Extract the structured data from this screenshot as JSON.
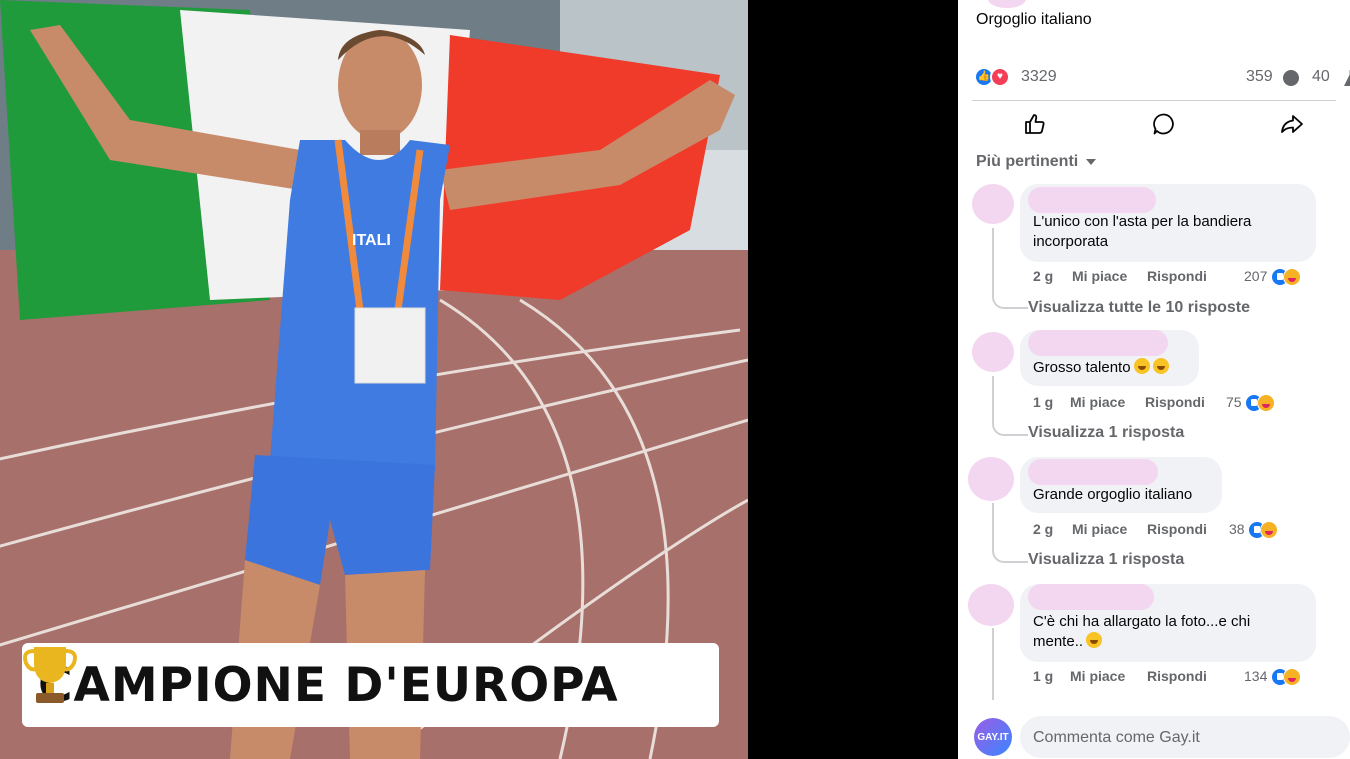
{
  "photo": {
    "caption": "CAMPIONE D'EUROPA",
    "trophy_icon": "trophy-icon",
    "jersey_text": "ITALI",
    "flag_colors": [
      "#1f9b3b",
      "#f2f2f2",
      "#f03a2a"
    ]
  },
  "post": {
    "text": "Orgoglio italiano",
    "reaction_count": "3329",
    "comment_count": "359",
    "share_count": "40"
  },
  "actions": {
    "like_icon": "like-icon",
    "comment_icon": "comment-icon",
    "share_icon": "share-icon"
  },
  "sort_label": "Più pertinenti",
  "comments": [
    {
      "text": "L'unico con l'asta per la bandiera incorporata",
      "time": "2 g",
      "like": "Mi piace",
      "reply": "Rispondi",
      "reactions": "207",
      "replies_link": "Visualizza tutte le 10 risposte"
    },
    {
      "text": "Grosso talento",
      "time": "1 g",
      "like": "Mi piace",
      "reply": "Rispondi",
      "reactions": "75",
      "replies_link": "Visualizza 1 risposta"
    },
    {
      "text": "Grande orgoglio italiano",
      "time": "2 g",
      "like": "Mi piace",
      "reply": "Rispondi",
      "reactions": "38",
      "replies_link": "Visualizza 1 risposta"
    },
    {
      "text": "C'è chi ha allargato la foto...e chi mente..",
      "time": "1 g",
      "like": "Mi piace",
      "reply": "Rispondi",
      "reactions": "134"
    }
  ],
  "compose": {
    "placeholder": "Commenta come Gay.it",
    "avatar_text": "GAY.IT"
  },
  "colors": {
    "accent": "#1877f2",
    "love": "#f33e58",
    "muted": "#65676b",
    "bubble": "#f0f2f5",
    "redaction": "#f3d6ef"
  }
}
